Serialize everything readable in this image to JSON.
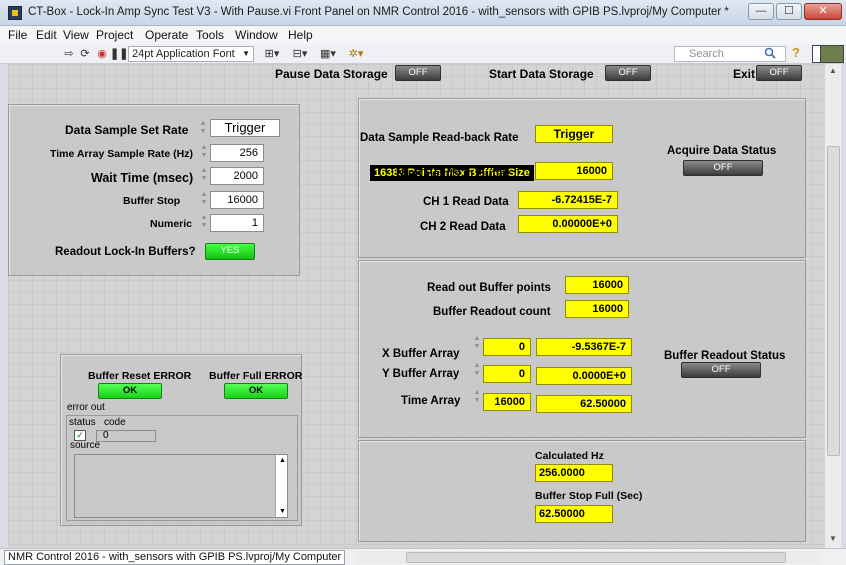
{
  "window": {
    "title": "CT-Box - Lock-In Amp Sync Test V3 - With Pause.vi Front Panel on NMR Control 2016 - with_sensors with GPIB PS.lvproj/My Computer *",
    "minimize": "—",
    "maximize": "☐",
    "close": "✕"
  },
  "menu": [
    "File",
    "Edit",
    "View",
    "Project",
    "Operate",
    "Tools",
    "Window",
    "Help"
  ],
  "toolbar": {
    "font": "24pt Application Font",
    "search_placeholder": "Search"
  },
  "top_controls": {
    "pause_label": "Pause Data Storage",
    "pause_value": "OFF",
    "start_label": "Start Data Storage",
    "start_value": "OFF",
    "exit_label": "Exit",
    "exit_value": "OFF"
  },
  "settings": {
    "rate_label": "Data Sample Set Rate",
    "rate_value": "Trigger",
    "time_rate_label": "Time Array Sample Rate (Hz)",
    "time_rate_value": "256",
    "wait_label": "Wait Time (msec)",
    "wait_value": "2000",
    "buffer_stop_label": "Buffer Stop",
    "buffer_stop_value": "16000",
    "numeric_label": "Numeric",
    "numeric_value": "1",
    "readout_label": "Readout Lock-In Buffers?",
    "readout_value": "YES"
  },
  "status_panel": {
    "banner": "16383 Points Max Bufffer Size",
    "readback_label": "Data Sample Read-back Rate",
    "readback_value": "Trigger",
    "num_points_label": "Num Points in Buffer",
    "num_points_value": "16000",
    "ch1_label": "CH 1 Read Data",
    "ch1_value": "-6.72415E-7",
    "ch2_label": "CH 2 Read Data",
    "ch2_value": "0.00000E+0",
    "acquire_label": "Acquire Data Status",
    "acquire_value": "OFF"
  },
  "readout_panel": {
    "points_label": "Read out Buffer points",
    "points_value": "16000",
    "count_label": "Buffer Readout count",
    "count_value": "16000",
    "x_label": "X Buffer Array",
    "x_index": "0",
    "x_value": "-9.5367E-7",
    "y_label": "Y Buffer Array",
    "y_index": "0",
    "y_value": "0.0000E+0",
    "t_label": "Time Array",
    "t_index": "16000",
    "t_value": "62.50000",
    "status_label": "Buffer Readout Status",
    "status_value": "OFF"
  },
  "calc_panel": {
    "hz_label": "Calculated Hz",
    "hz_value": "256.0000",
    "stop_label": "Buffer Stop Full (Sec)",
    "stop_value": "62.50000"
  },
  "errors": {
    "reset_label": "Buffer Reset ERROR",
    "reset_value": "OK",
    "full_label": "Buffer Full ERROR",
    "full_value": "OK",
    "error_out": "error out",
    "status": "status",
    "code": "code",
    "code_value": "0",
    "source": "source"
  },
  "statusbar": {
    "project": "NMR Control 2016 - with_sensors with GPIB PS.lvproj/My Computer"
  }
}
